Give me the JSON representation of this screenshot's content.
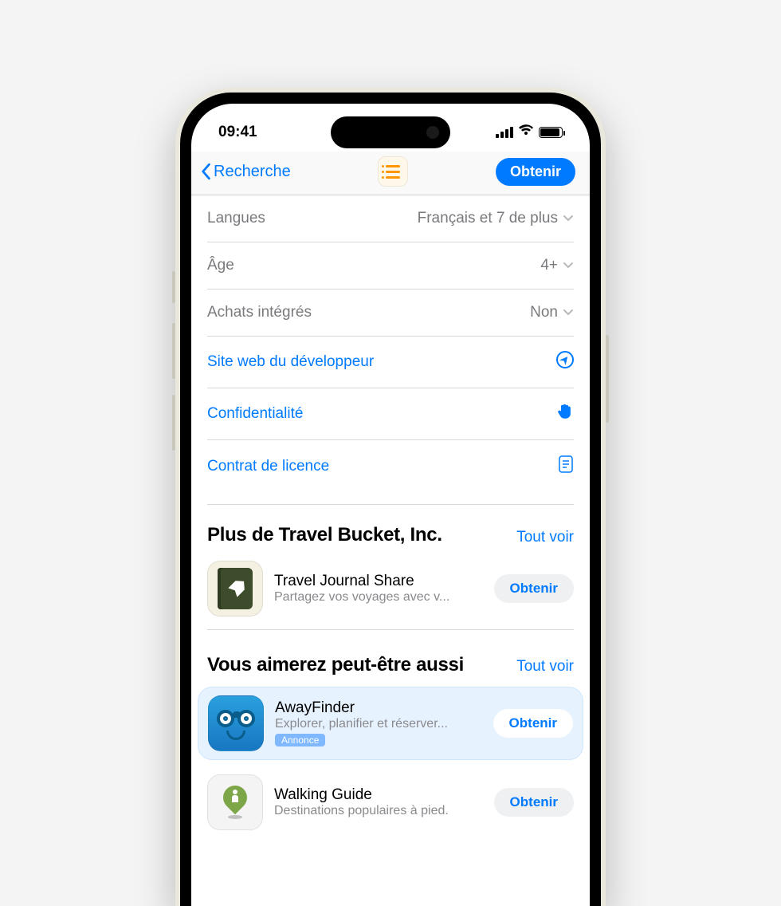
{
  "status": {
    "time": "09:41"
  },
  "nav": {
    "back": "Recherche",
    "action": "Obtenir"
  },
  "details": {
    "languages_label": "Langues",
    "languages_value": "Français et 7 de plus",
    "age_label": "Âge",
    "age_value": "4+",
    "iap_label": "Achats intégrés",
    "iap_value": "Non",
    "dev_site": "Site web du développeur",
    "privacy": "Confidentialité",
    "license": "Contrat de licence"
  },
  "sections": {
    "more_title": "Plus de Travel Bucket, Inc.",
    "also_title": "Vous aimerez peut-être aussi",
    "see_all": "Tout voir"
  },
  "apps": {
    "journal": {
      "name": "Travel Journal Share",
      "sub": "Partagez vos voyages avec v...",
      "btn": "Obtenir"
    },
    "away": {
      "name": "AwayFinder",
      "sub": "Explorer, planifier et réserver...",
      "btn": "Obtenir",
      "ad": "Annonce"
    },
    "walk": {
      "name": "Walking Guide",
      "sub": "Destinations populaires à pied.",
      "btn": "Obtenir"
    }
  }
}
